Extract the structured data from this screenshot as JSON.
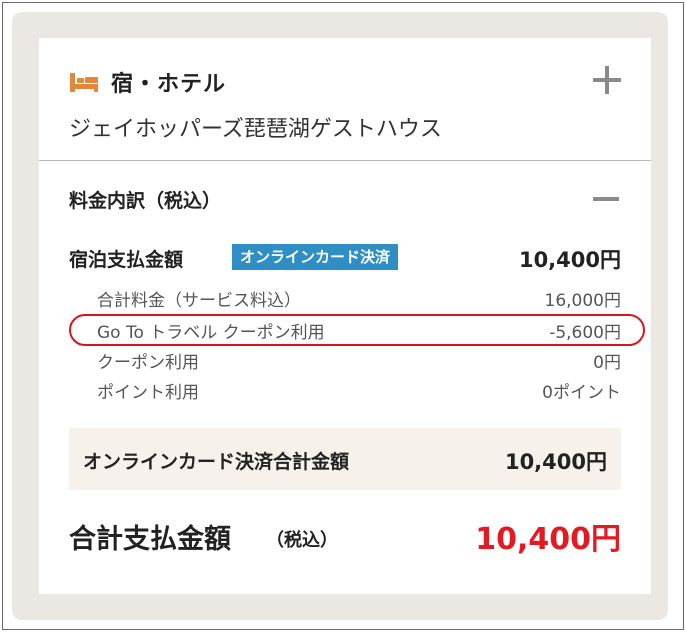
{
  "colors": {
    "accent_red": "#e21b23",
    "badge_blue": "#2f8ec4",
    "bed_icon_orange": "#e3873c",
    "highlight_ring": "#d9141e"
  },
  "hotel": {
    "category": "宿・ホテル",
    "name": "ジェイホッパーズ琵琶湖ゲストハウス",
    "icon": "bed-icon"
  },
  "breakdown": {
    "title": "料金内訳（税込）",
    "payment": {
      "label": "宿泊支払金額",
      "badge": "オンラインカード決済",
      "amount": "10,400円"
    },
    "details": [
      {
        "label": "合計料金（サービス料込）",
        "value": "16,000円"
      },
      {
        "label": "Go To トラベル クーポン利用",
        "value": "-5,600円"
      },
      {
        "label": "クーポン利用",
        "value": "0円"
      },
      {
        "label": "ポイント利用",
        "value": "0ポイント"
      }
    ],
    "online_total": {
      "label": "オンラインカード決済合計金額",
      "amount": "10,400円"
    },
    "grand_total": {
      "label": "合計支払金額",
      "sub": "（税込）",
      "amount": "10,400円"
    }
  }
}
